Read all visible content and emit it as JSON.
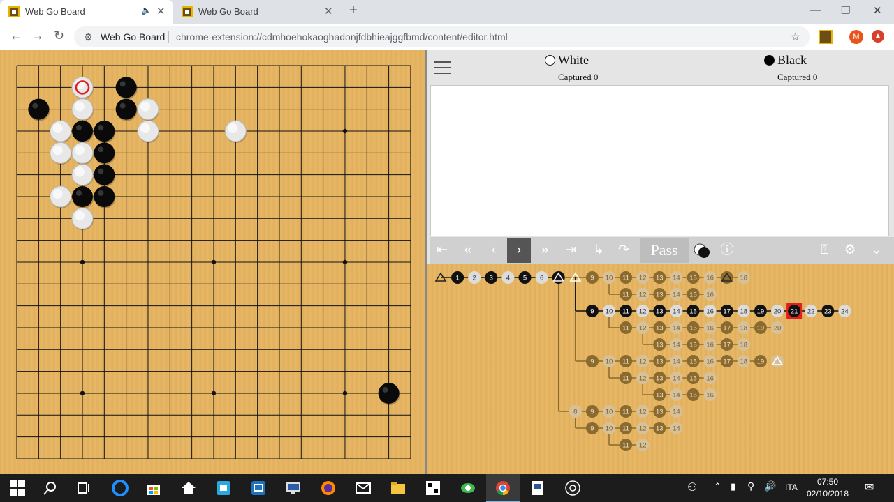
{
  "browser": {
    "tabs": [
      {
        "title": "Web Go Board"
      },
      {
        "title": "Web Go Board"
      }
    ],
    "site_name": "Web Go Board",
    "url": "chrome-extension://cdmhoehokaoghadonjfdbhieajggfbmd/content/editor.html",
    "profile_initial": "M"
  },
  "players": {
    "white": {
      "name": "White",
      "captured": "Captured 0"
    },
    "black": {
      "name": "Black",
      "captured": "Captured 0"
    }
  },
  "controls": {
    "pass_label": "Pass"
  },
  "board": {
    "size": 19,
    "view": "partial 18 columns x 19 rows",
    "stones": [
      {
        "col": 3,
        "row": 1,
        "color": "white",
        "last_move": true
      },
      {
        "col": 5,
        "row": 1,
        "color": "black"
      },
      {
        "col": 1,
        "row": 2,
        "color": "black"
      },
      {
        "col": 3,
        "row": 2,
        "color": "white"
      },
      {
        "col": 5,
        "row": 2,
        "color": "black"
      },
      {
        "col": 6,
        "row": 2,
        "color": "white"
      },
      {
        "col": 2,
        "row": 3,
        "color": "white"
      },
      {
        "col": 3,
        "row": 3,
        "color": "black"
      },
      {
        "col": 4,
        "row": 3,
        "color": "black"
      },
      {
        "col": 6,
        "row": 3,
        "color": "white"
      },
      {
        "col": 10,
        "row": 3,
        "color": "white"
      },
      {
        "col": 2,
        "row": 4,
        "color": "white"
      },
      {
        "col": 3,
        "row": 4,
        "color": "white"
      },
      {
        "col": 4,
        "row": 4,
        "color": "black"
      },
      {
        "col": 3,
        "row": 5,
        "color": "white"
      },
      {
        "col": 4,
        "row": 5,
        "color": "black"
      },
      {
        "col": 2,
        "row": 6,
        "color": "white"
      },
      {
        "col": 3,
        "row": 6,
        "color": "black"
      },
      {
        "col": 4,
        "row": 6,
        "color": "black"
      },
      {
        "col": 3,
        "row": 7,
        "color": "white"
      },
      {
        "col": 17,
        "row": 15,
        "color": "black"
      }
    ]
  },
  "tree": {
    "main_line": [
      "1",
      "2",
      "3",
      "4",
      "5",
      "6",
      "",
      "",
      "9",
      "10",
      "11",
      "12",
      "13",
      "14",
      "15",
      "16",
      "",
      "18"
    ],
    "variations": [
      {
        "from": 11,
        "nodes": [
          "11",
          "12",
          "13",
          "14",
          "15",
          "16"
        ]
      },
      {
        "from": 9,
        "nodes": [
          "9",
          "10",
          "11",
          "12",
          "13",
          "14",
          "15",
          "16",
          "17",
          "18",
          "19",
          "20",
          "21",
          "22",
          "23",
          "24"
        ],
        "current": "21"
      },
      {
        "from": 11,
        "nodes": [
          "11",
          "12",
          "13",
          "14",
          "15",
          "16",
          "17",
          "18",
          "19",
          "20"
        ]
      },
      {
        "from": 13,
        "nodes": [
          "13",
          "14",
          "15",
          "16",
          "17",
          "18"
        ]
      },
      {
        "from": 9,
        "nodes": [
          "9",
          "10",
          "11",
          "12",
          "13",
          "14",
          "15",
          "16",
          "17",
          "18",
          "19"
        ]
      },
      {
        "from": 11,
        "nodes": [
          "11",
          "12",
          "13",
          "14",
          "15",
          "16"
        ]
      },
      {
        "from": 13,
        "nodes": [
          "13",
          "14",
          "15",
          "16"
        ]
      },
      {
        "from": 8,
        "nodes": [
          "8",
          "9",
          "10",
          "11",
          "12",
          "13",
          "14"
        ]
      },
      {
        "from": 9,
        "nodes": [
          "9",
          "10",
          "11",
          "12",
          "13",
          "14"
        ]
      },
      {
        "from": 11,
        "nodes": [
          "11",
          "12"
        ]
      }
    ]
  },
  "taskbar": {
    "language": "ITA",
    "time": "07:50",
    "date": "02/10/2018"
  },
  "colors": {
    "board_wood": "#e5b461",
    "accent_red": "#e02020",
    "panel_gray": "#e5e5e5"
  }
}
